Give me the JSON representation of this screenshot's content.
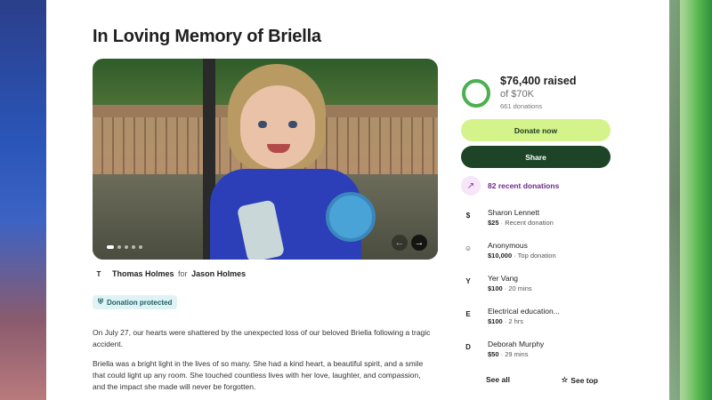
{
  "campaign": {
    "title": "In Loving Memory of Briella",
    "organizer": {
      "icon": "user-icon",
      "icon_glyph": "T",
      "name": "Thomas Holmes",
      "for_text": "for",
      "beneficiary": "Jason Holmes"
    },
    "protected_badge": "Donation protected",
    "story": [
      "On July 27, our hearts were shattered by the unexpected loss of our beloved Briella following a tragic accident.",
      "Briella was a bright light in the lives of so many. She had a kind heart, a beautiful spirit, and a smile that could light up any room. She touched countless lives with her love, laughter, and compassion, and the impact she made will never be forgotten."
    ],
    "hero": {
      "prev_glyph": "←",
      "next_glyph": "→"
    }
  },
  "sidebar": {
    "raised": "$76,400 raised",
    "goal": "of $70K",
    "donations_count": "661 donations",
    "progress_fraction": 1.0,
    "progress_color": "#4caf50",
    "donate_label": "Donate now",
    "share_label": "Share",
    "recent_label": "82 recent donations",
    "recent_icon_glyph": "↗",
    "donations": [
      {
        "icon_glyph": "$",
        "icon": "dollar-icon",
        "name": "Sharon Lennett",
        "amount": "$25",
        "note": "Recent donation"
      },
      {
        "icon_glyph": "☺",
        "icon": "hand-heart-icon",
        "name": "Anonymous",
        "amount": "$10,000",
        "note": "Top donation"
      },
      {
        "icon_glyph": "Y",
        "icon": "initial-icon",
        "name": "Yer Vang",
        "amount": "$100",
        "note": "20 mins"
      },
      {
        "icon_glyph": "E",
        "icon": "initial-icon",
        "name": "Electrical education...",
        "amount": "$100",
        "note": "2 hrs"
      },
      {
        "icon_glyph": "D",
        "icon": "initial-icon",
        "name": "Deborah Murphy",
        "amount": "$50",
        "note": "29 mins"
      }
    ],
    "see_all_label": "See all",
    "see_top_label": "See top",
    "see_top_glyph": "☆"
  },
  "colors": {
    "donate_bg": "#d4f38a",
    "share_bg": "#1e4428",
    "recent_accent": "#6b2a8a"
  }
}
